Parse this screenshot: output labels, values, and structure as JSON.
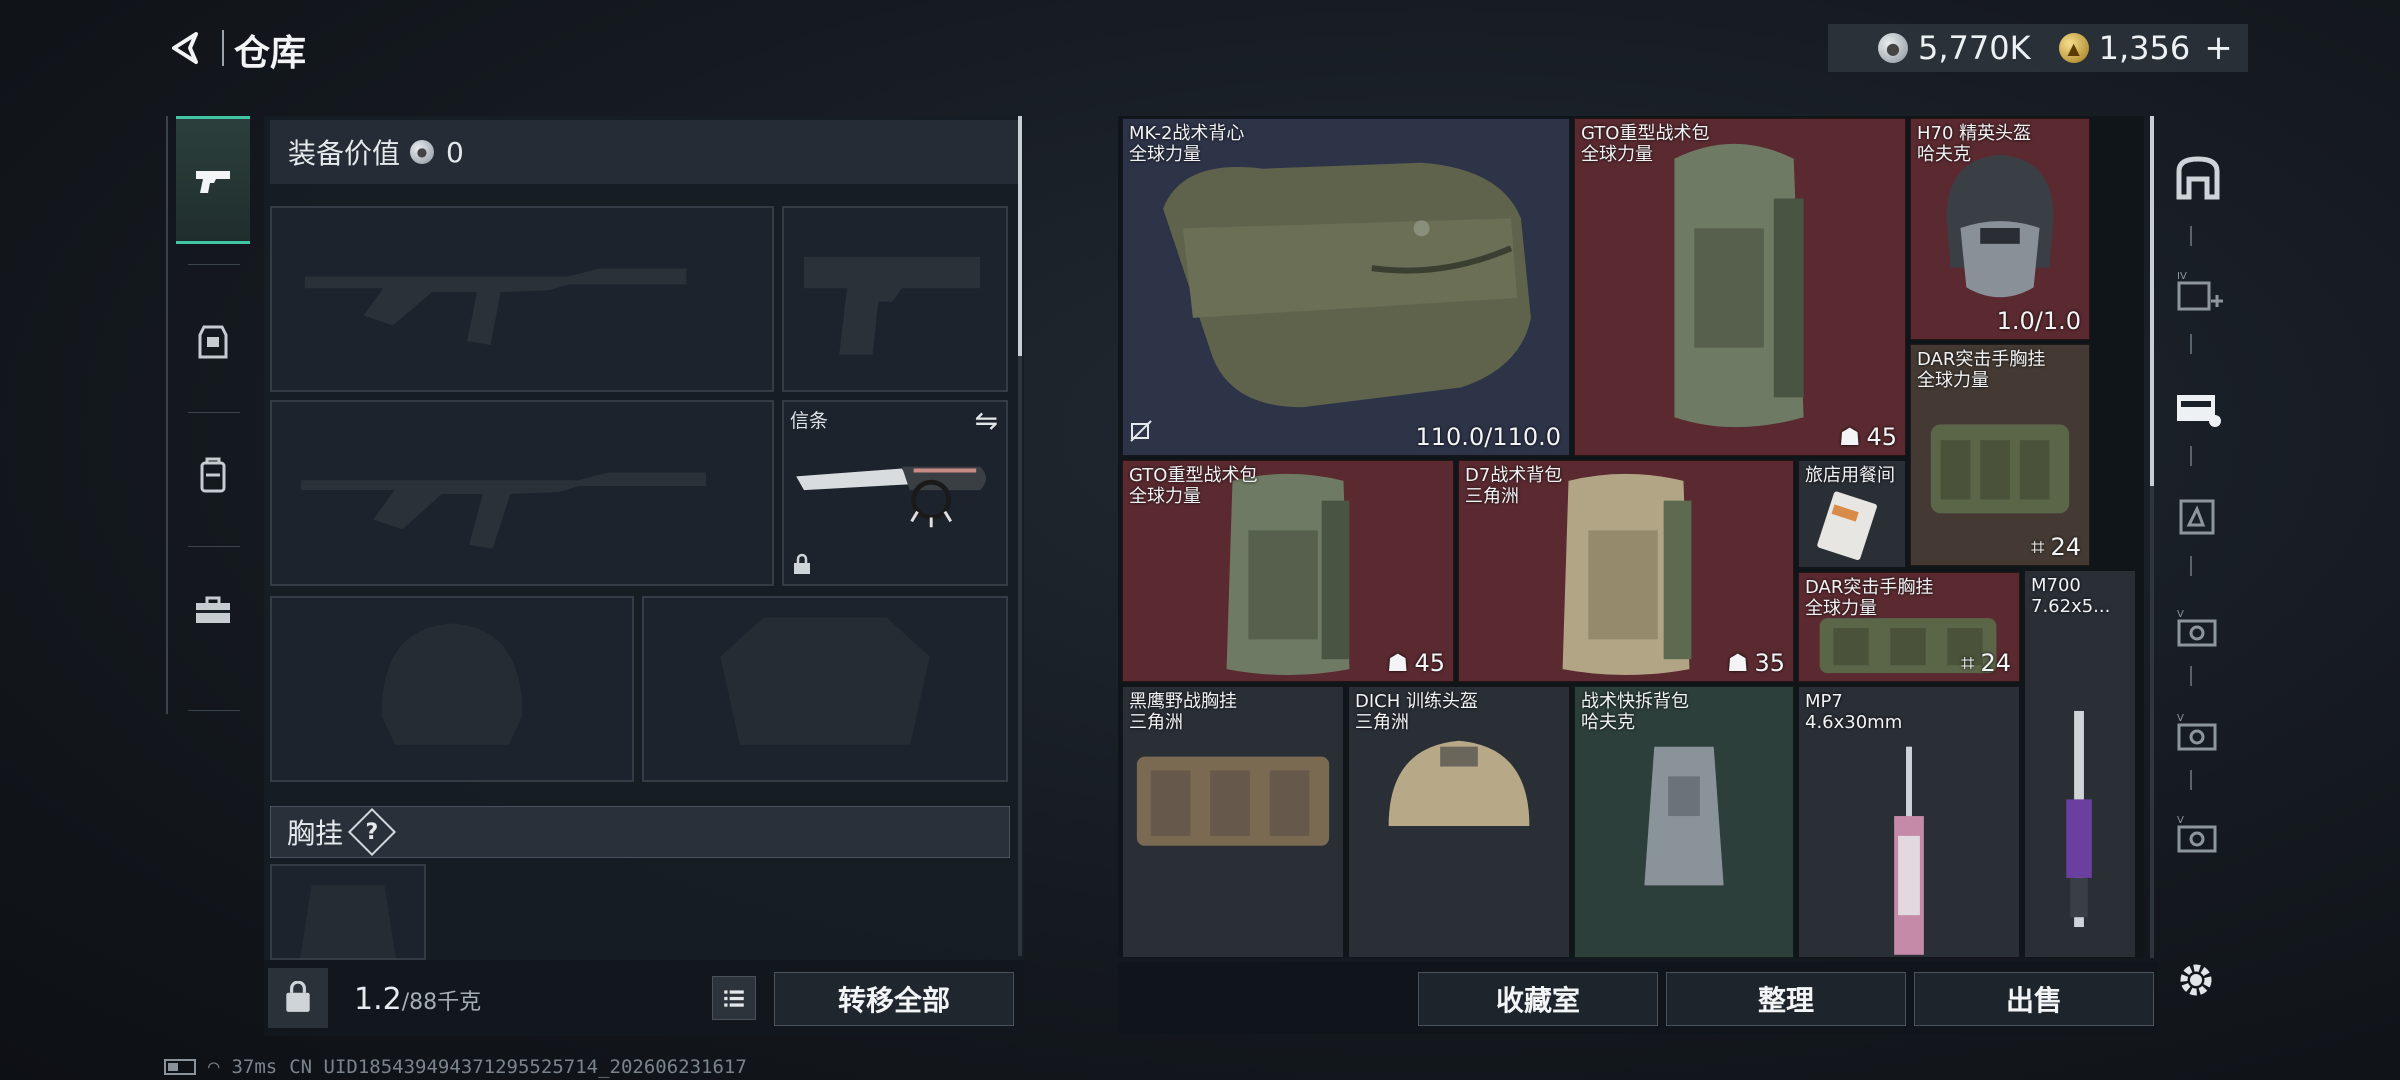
{
  "header": {
    "title": "仓库",
    "currency": [
      {
        "icon": "silver-coin-icon",
        "amount": "5,770K"
      },
      {
        "icon": "gold-coin-icon",
        "amount": "1,356"
      }
    ],
    "add_label": "+"
  },
  "equip": {
    "value_label": "装备价值",
    "value": "0",
    "melee_label": "信条",
    "chest_rig_label": "胸挂",
    "help": "?",
    "weight_current": "1.2",
    "weight_max": "/88千克",
    "transfer_all": "转移全部"
  },
  "categories": [
    {
      "icon": "pistol-icon",
      "active": true
    },
    {
      "icon": "armor-vest-icon",
      "active": false
    },
    {
      "icon": "backpack-icon",
      "active": false
    },
    {
      "icon": "toolbox-icon",
      "active": false
    }
  ],
  "warehouse": {
    "items": [
      {
        "name": "MK-2战术背心\n全球力量",
        "stat": "110.0/110.0",
        "color": "blue"
      },
      {
        "name": "GTO重型战术包\n全球力量",
        "stat": "45",
        "color": "red"
      },
      {
        "name": "H70 精英头盔\n哈夫克",
        "stat": "1.0/1.0",
        "color": "red"
      },
      {
        "name": "DAR突击手胸挂\n全球力量",
        "stat": "24",
        "color": "brown"
      },
      {
        "name": "GTO重型战术包\n全球力量",
        "stat": "45",
        "color": "red"
      },
      {
        "name": "D7战术背包\n三角洲",
        "stat": "35",
        "color": "red"
      },
      {
        "name": "旅店用餐间",
        "stat": "",
        "color": "gray"
      },
      {
        "name": "DAR突击手胸挂\n全球力量",
        "stat": "24",
        "color": "red"
      },
      {
        "name": "M700\n7.62x5...",
        "stat": "",
        "color": "gray"
      },
      {
        "name": "黑鹰野战胸挂\n三角洲",
        "stat": "",
        "color": "gray"
      },
      {
        "name": "DICH 训练头盔\n三角洲",
        "stat": "",
        "color": "gray"
      },
      {
        "name": "战术快拆背包\n哈夫克",
        "stat": "",
        "color": "green"
      },
      {
        "name": "MP7\n4.6x30mm",
        "stat": "",
        "color": "gray"
      }
    ]
  },
  "actions": {
    "collection": "收藏室",
    "organize": "整理",
    "sell": "出售"
  },
  "status": {
    "ping": "37ms",
    "uid": "CN UID18543949437129552571​4_202606231617"
  },
  "colors": {
    "accent": "#42c5a2",
    "item_red": "#5a2a30",
    "item_blue": "#2e3448",
    "item_brown": "#443a33",
    "item_green": "#2d3f3b"
  }
}
